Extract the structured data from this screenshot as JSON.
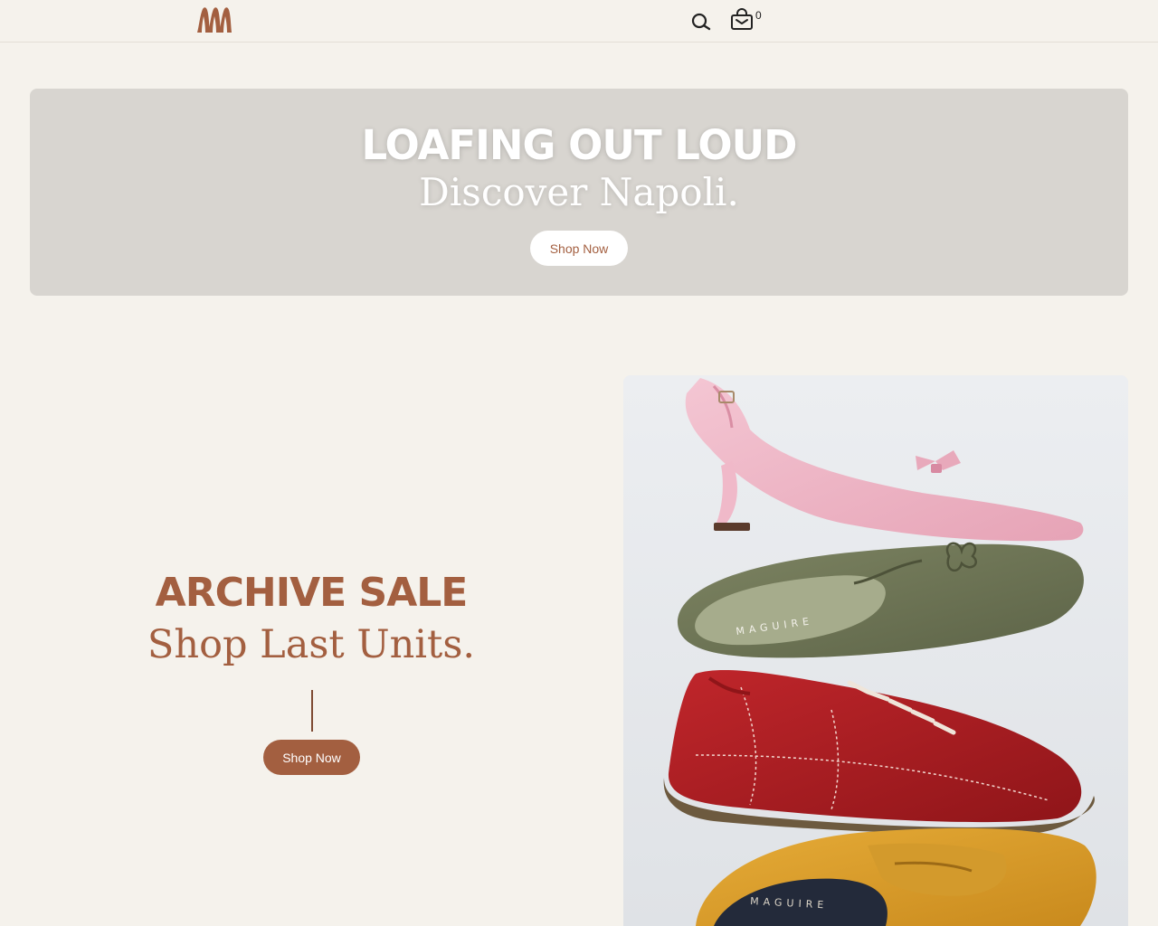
{
  "header": {
    "logo_alt": "Maguire",
    "search_icon": "search-icon",
    "cart_icon": "shopping-bag-icon",
    "cart_count": "0"
  },
  "hero": {
    "heading": "LOAFING OUT LOUD",
    "subheading": "Discover Napoli.",
    "button_label": "Shop Now"
  },
  "sale": {
    "heading": "ARCHIVE SALE",
    "subheading": "Shop Last Units.",
    "button_label": "Shop Now"
  },
  "product_image": {
    "brand_print_1": "MAGUIRE",
    "brand_print_2": "MAGUIRE"
  },
  "colors": {
    "brand": "#a35f40",
    "background": "#f5f2ec",
    "hero_bg": "#d8d5d0",
    "white": "#ffffff"
  }
}
